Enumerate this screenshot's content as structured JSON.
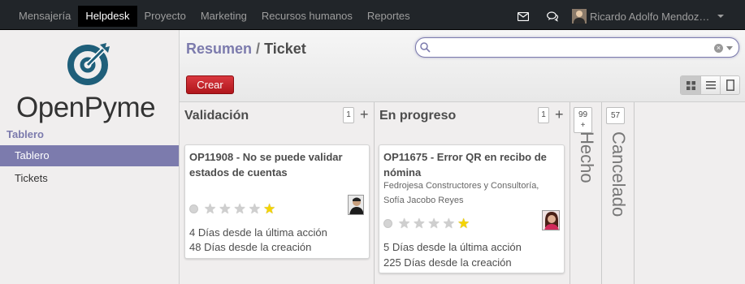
{
  "topbar": {
    "menu": [
      "Mensajería",
      "Helpdesk",
      "Proyecto",
      "Marketing",
      "Recursos humanos",
      "Reportes"
    ],
    "active_menu": "Helpdesk",
    "mail_icon": "envelope-icon",
    "chat_icon": "chat-bubbles-icon",
    "user_name": "Ricardo Adolfo Mendoz…"
  },
  "sidebar": {
    "logo_text": "OpenPyme",
    "section": "Tablero",
    "items": [
      "Tablero",
      "Tickets"
    ]
  },
  "control_panel": {
    "breadcrumb_parent": "Resumen",
    "breadcrumb_sep": "/",
    "breadcrumb_current": "Ticket",
    "search_placeholder": "",
    "create_label": "Crear",
    "views": [
      "kanban-view-icon",
      "list-view-icon",
      "form-view-icon"
    ]
  },
  "kanban": {
    "columns": [
      {
        "title": "Validación",
        "count": "1",
        "cards": [
          {
            "title": "OP11908 - No se puede validar estados de cuentas",
            "subtitle": [],
            "priority_stars": 5,
            "last_action": "4 Días desde la última acción",
            "created": "48 Días desde la creación"
          }
        ]
      },
      {
        "title": "En progreso",
        "count": "1",
        "cards": [
          {
            "title": "OP11675 - Error QR en recibo de nómina",
            "subtitle": [
              "Fedrojesa Constructores y Consultoría,",
              "Sofía Jacobo Reyes"
            ],
            "priority_stars": 5,
            "last_action": "5 Días desde la última acción",
            "created": "225 Días desde la creación"
          }
        ]
      }
    ],
    "folded": [
      {
        "title": "Hecho",
        "count": "99 +"
      },
      {
        "title": "Cancelado",
        "count": "57"
      }
    ]
  },
  "colors": {
    "accent": "#7c7bad",
    "create_button": "#c0191f",
    "topbar": "#212529",
    "star_on": "#f5d400"
  }
}
